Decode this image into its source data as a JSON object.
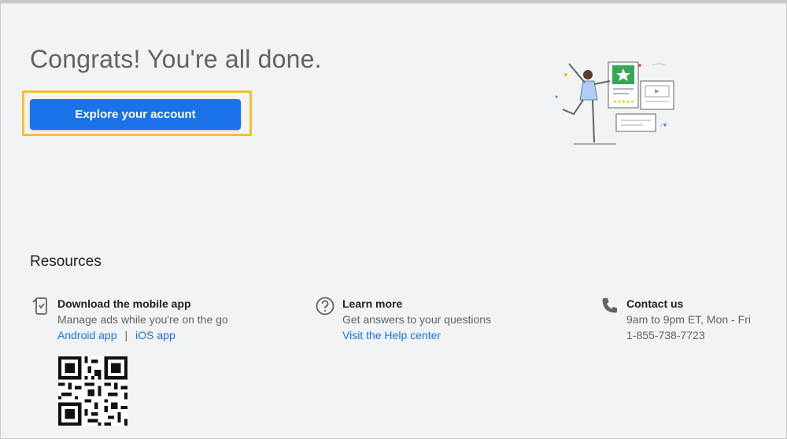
{
  "page": {
    "title": "Congrats! You're all done.",
    "primary_button": "Explore your account",
    "highlight_color": "#f6c02b",
    "accent_color": "#1a73e8"
  },
  "resources": {
    "title": "Resources",
    "items": [
      {
        "icon": "phone-download-icon",
        "title": "Download the mobile app",
        "subtitle": "Manage ads while you're on the go",
        "links": [
          "Android app",
          "iOS app"
        ],
        "separator": "|"
      },
      {
        "icon": "help-circle-icon",
        "title": "Learn more",
        "subtitle": "Get answers to your questions",
        "links": [
          "Visit the Help center"
        ]
      },
      {
        "icon": "phone-icon",
        "title": "Contact us",
        "lines": [
          "9am to 9pm ET, Mon - Fri",
          "1-855-738-7723"
        ]
      }
    ],
    "qr_code": "qr-code-icon"
  }
}
